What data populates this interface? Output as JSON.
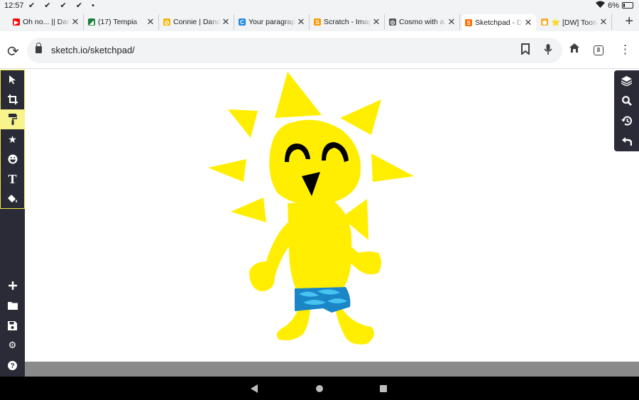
{
  "status": {
    "time": "12:57",
    "notifications": "✔ ✔ ✔ ✔ •",
    "battery": "6%"
  },
  "tabs": [
    {
      "title": "Oh no... || Dan",
      "favicon_color": "#ff0000",
      "favicon": "▶"
    },
    {
      "title": "(17) Tempia",
      "favicon_color": "#1a7f3b",
      "favicon": "◢"
    },
    {
      "title": "Connie | Dand",
      "favicon_color": "#f4b400",
      "favicon": "◎"
    },
    {
      "title": "Your paragrap",
      "favicon_color": "#1e88e5",
      "favicon": "C"
    },
    {
      "title": "Scratch - Imag",
      "favicon_color": "#ff9800",
      "favicon": "S"
    },
    {
      "title": "Cosmo with a",
      "favicon_color": "#555555",
      "favicon": "◎"
    },
    {
      "title": "Sketchpad - D",
      "favicon_color": "#ff6d00",
      "favicon": "S"
    },
    {
      "title": "⭐ [DW] Toon",
      "favicon_color": "#f9a825",
      "favicon": "◉"
    }
  ],
  "address": {
    "url": "sketch.io/sketchpad/",
    "tab_count": "8"
  },
  "colors": {
    "sun": "#ffee00",
    "shorts": "#1a86c8",
    "shorts_light": "#47c3f0",
    "toolbar_bg": "#2b2b38"
  }
}
